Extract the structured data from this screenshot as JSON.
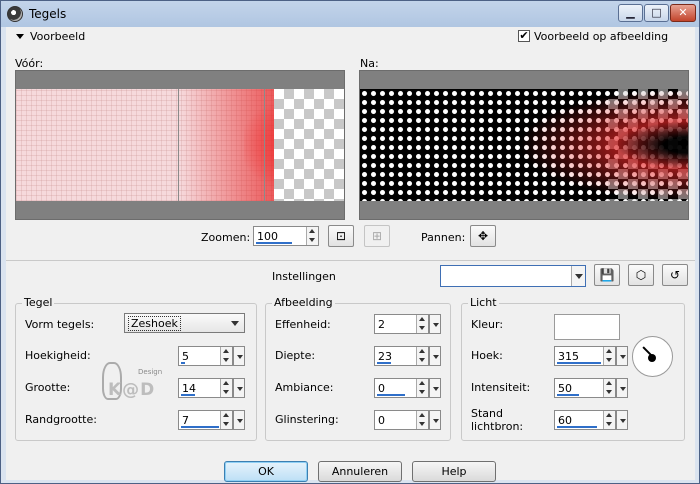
{
  "window": {
    "title": "Tegels",
    "controls": {
      "minimize": "minimize-icon",
      "maximize": "maximize-icon",
      "close": "close-icon"
    }
  },
  "preview": {
    "toggle_label": "Voorbeeld",
    "on_image_label": "Voorbeeld op afbeelding",
    "on_image_checked": true,
    "before_label": "Vóór:",
    "after_label": "Na:"
  },
  "zoom": {
    "label": "Zoomen:",
    "value": "100",
    "pan_label": "Pannen:"
  },
  "settings": {
    "label": "Instellingen",
    "preset_value": ""
  },
  "tegel": {
    "title": "Tegel",
    "shape_label": "Vorm tegels:",
    "shape_value": "Zeshoek",
    "angularity_label": "Hoekigheid:",
    "angularity_value": "5",
    "size_label": "Grootte:",
    "size_value": "14",
    "border_label": "Randgrootte:",
    "border_value": "7"
  },
  "afbeelding": {
    "title": "Afbeelding",
    "smoothness_label": "Effenheid:",
    "smoothness_value": "2",
    "depth_label": "Diepte:",
    "depth_value": "23",
    "ambience_label": "Ambiance:",
    "ambience_value": "0",
    "shine_label": "Glinstering:",
    "shine_value": "0"
  },
  "licht": {
    "title": "Licht",
    "color_label": "Kleur:",
    "color_value": "#ffffff",
    "angle_label": "Hoek:",
    "angle_value": "315",
    "intensity_label": "Intensiteit:",
    "intensity_value": "50",
    "source_label_1": "Stand",
    "source_label_2": "lichtbron:",
    "source_value": "60"
  },
  "buttons": {
    "ok": "OK",
    "cancel": "Annuleren",
    "help": "Help"
  },
  "watermark": {
    "text": "K@D",
    "small": "Design"
  },
  "colors": {
    "accent_underline": "#2f6fc9",
    "preview_red": "#e62020",
    "window_frame": "#b0c6e2"
  }
}
